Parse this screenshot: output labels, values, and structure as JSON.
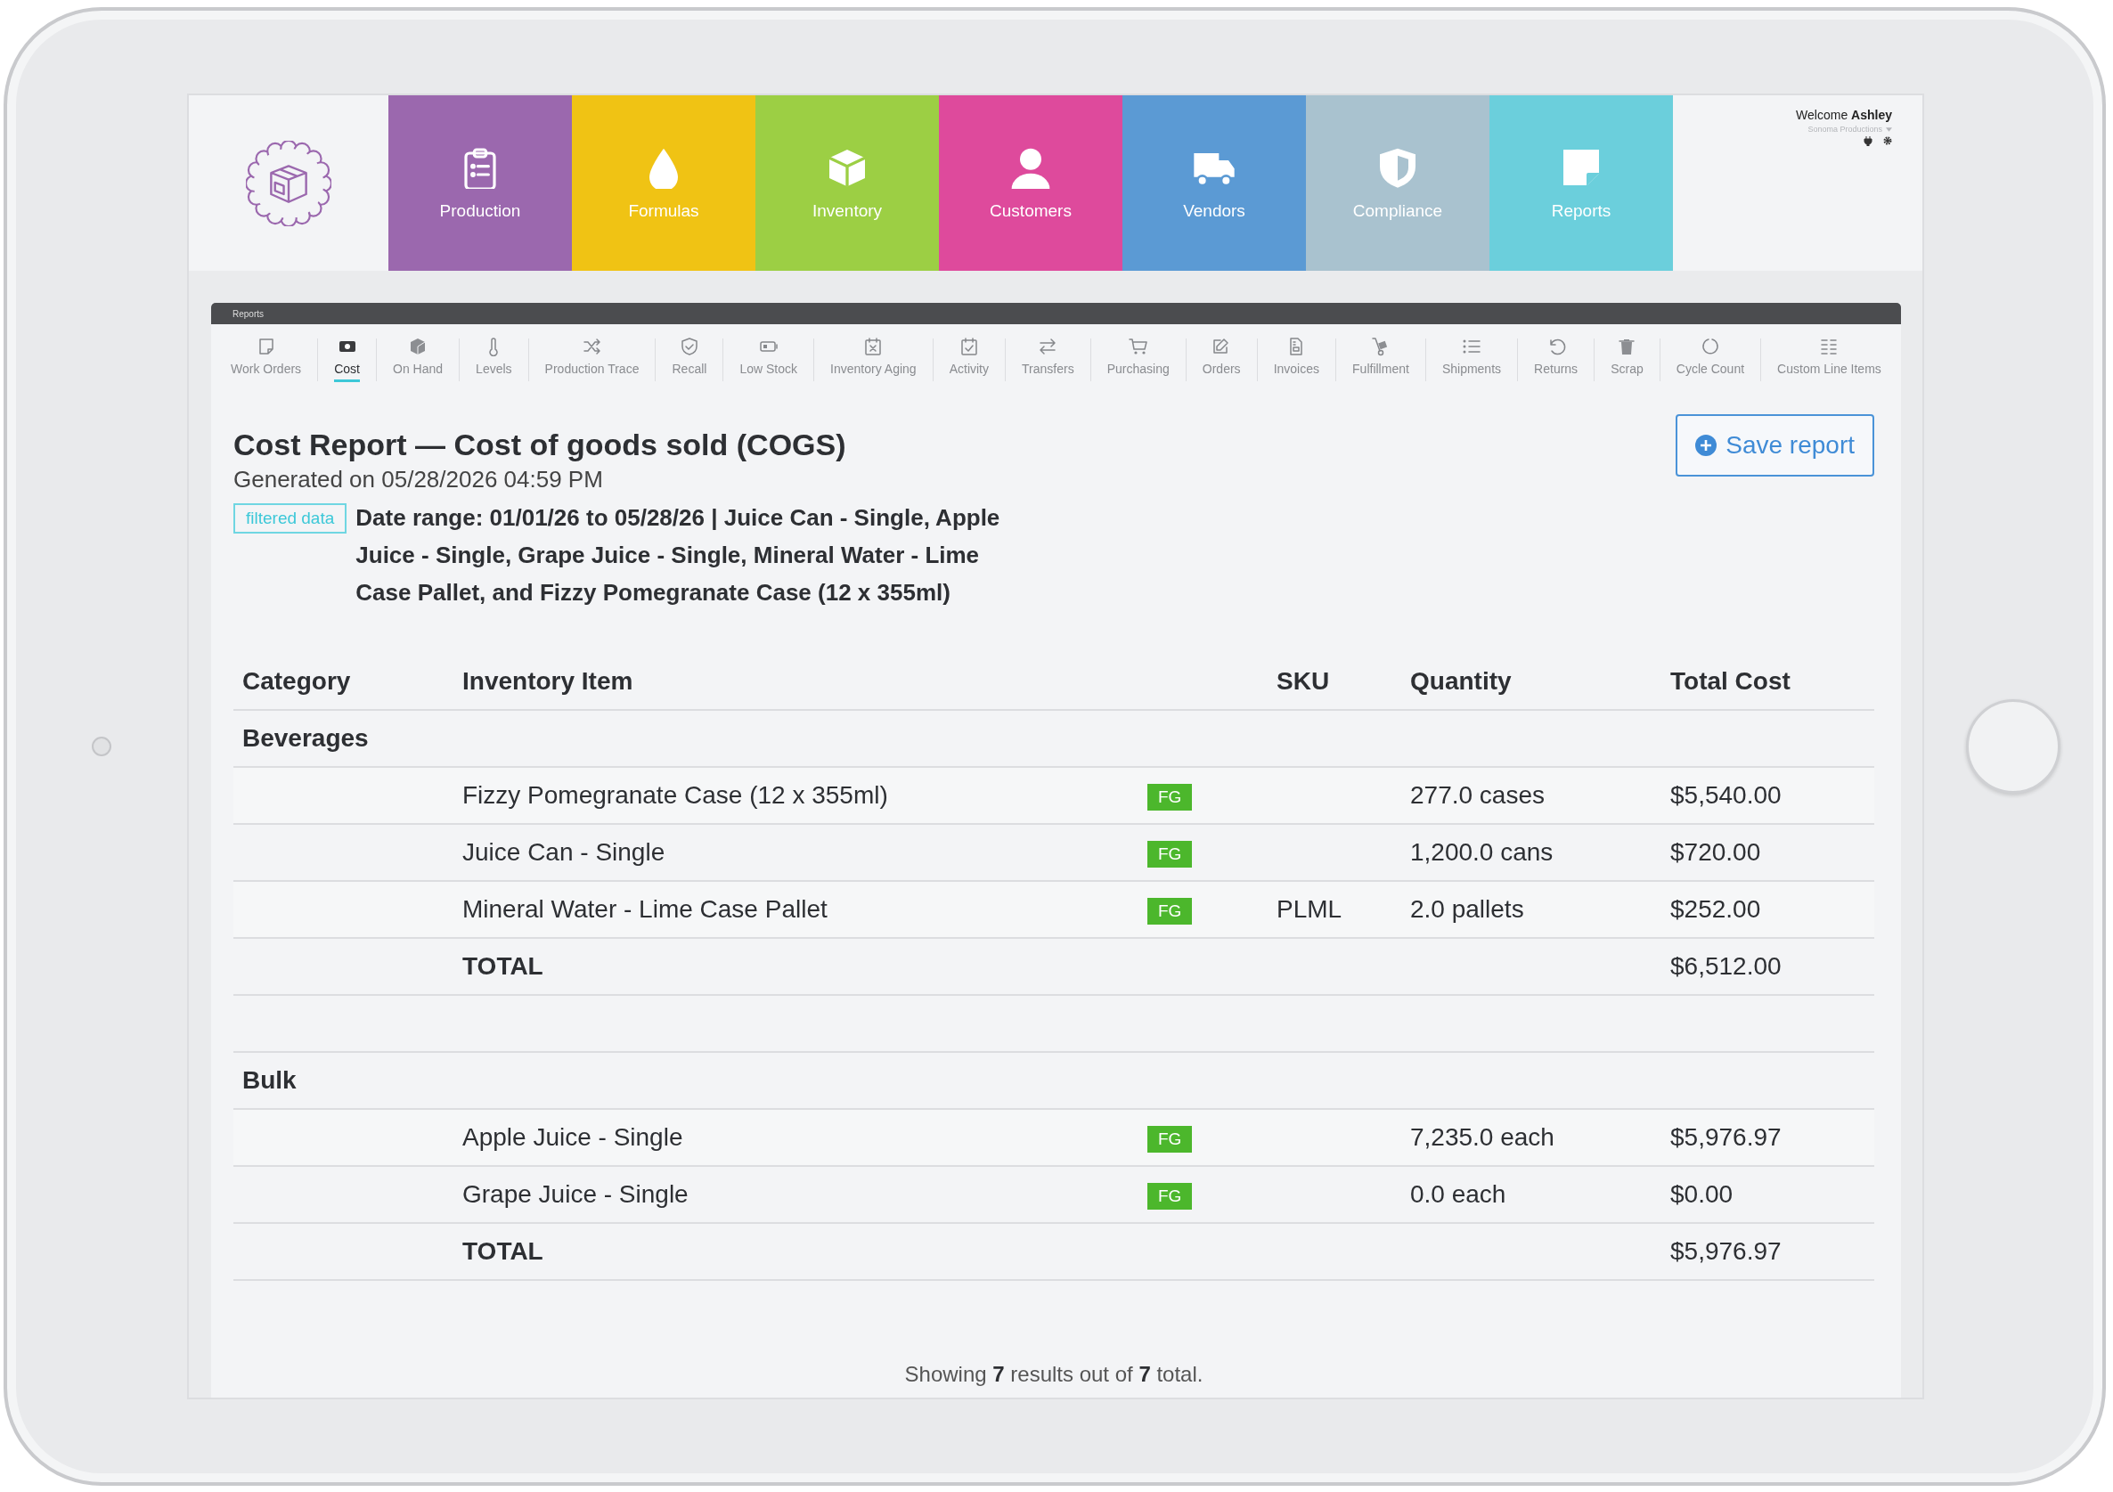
{
  "header": {
    "welcome": "Welcome **Ashley**",
    "organization": "Sonoma Productions"
  },
  "nav_tiles": [
    {
      "label": "Production",
      "color": "#9b68ae"
    },
    {
      "label": "Formulas",
      "color": "#f0c314"
    },
    {
      "label": "Inventory",
      "color": "#9ccf44"
    },
    {
      "label": "Customers",
      "color": "#de4a9c"
    },
    {
      "label": "Vendors",
      "color": "#5b9ad4"
    },
    {
      "label": "Compliance",
      "color": "#a9c2cf"
    },
    {
      "label": "Reports",
      "color": "#6bcfdc"
    }
  ],
  "section_bar": {
    "title": "Reports"
  },
  "report_tabs": [
    {
      "label": "Work Orders",
      "selected": false
    },
    {
      "label": "Cost",
      "selected": true
    },
    {
      "label": "On Hand",
      "selected": false
    },
    {
      "label": "Levels",
      "selected": false
    },
    {
      "label": "Production Trace",
      "selected": false
    },
    {
      "label": "Recall",
      "selected": false
    },
    {
      "label": "Low Stock",
      "selected": false
    },
    {
      "label": "Inventory Aging",
      "selected": false
    },
    {
      "label": "Activity",
      "selected": false
    },
    {
      "label": "Transfers",
      "selected": false
    },
    {
      "label": "Purchasing",
      "selected": false
    },
    {
      "label": "Orders",
      "selected": false
    },
    {
      "label": "Invoices",
      "selected": false
    },
    {
      "label": "Fulfillment",
      "selected": false
    },
    {
      "label": "Shipments",
      "selected": false
    },
    {
      "label": "Returns",
      "selected": false
    },
    {
      "label": "Scrap",
      "selected": false
    },
    {
      "label": "Cycle Count",
      "selected": false
    },
    {
      "label": "Custom Line Items",
      "selected": false
    }
  ],
  "report": {
    "title": "Cost Report — Cost of goods sold (COGS)",
    "generated": "Generated on 05/28/2026 04:59 PM",
    "filter_badge": "filtered data",
    "filter_text": "Date range: 01/01/26 to 05/28/26 | Juice Can - Single, Apple Juice - Single, Grape Juice - Single, Mineral Water - Lime Case Pallet, and Fizzy Pomegranate Case (12 x 355ml)",
    "save_button": "Save report"
  },
  "table": {
    "columns": [
      "Category",
      "Inventory Item",
      "SKU",
      "Quantity",
      "Total Cost"
    ],
    "groups": [
      {
        "name": "Beverages",
        "rows": [
          {
            "item": "Fizzy Pomegranate Case (12 x 355ml)",
            "tag": "FG",
            "quantity": "277.0 cases",
            "total_cost": "$5,540.00"
          },
          {
            "item": "Juice Can - Single",
            "tag": "FG",
            "quantity": "1,200.0 cans",
            "total_cost": "$720.00"
          },
          {
            "item": "Mineral Water - Lime Case Pallet",
            "tag": "FG",
            "sku": "PLML",
            "quantity": "2.0 pallets",
            "total_cost": "$252.00"
          }
        ],
        "total_label": "TOTAL",
        "total": "$6,512.00"
      },
      {
        "name": "Bulk",
        "rows": [
          {
            "item": "Apple Juice - Single",
            "tag": "FG",
            "quantity": "7,235.0 each",
            "total_cost": "$5,976.97"
          },
          {
            "item": "Grape Juice - Single",
            "tag": "FG",
            "quantity": "0.0 each",
            "total_cost": "$0.00"
          }
        ],
        "total_label": "TOTAL",
        "total": "$5,976.97"
      }
    ]
  },
  "footer": "Showing **7** results out of **7** total."
}
